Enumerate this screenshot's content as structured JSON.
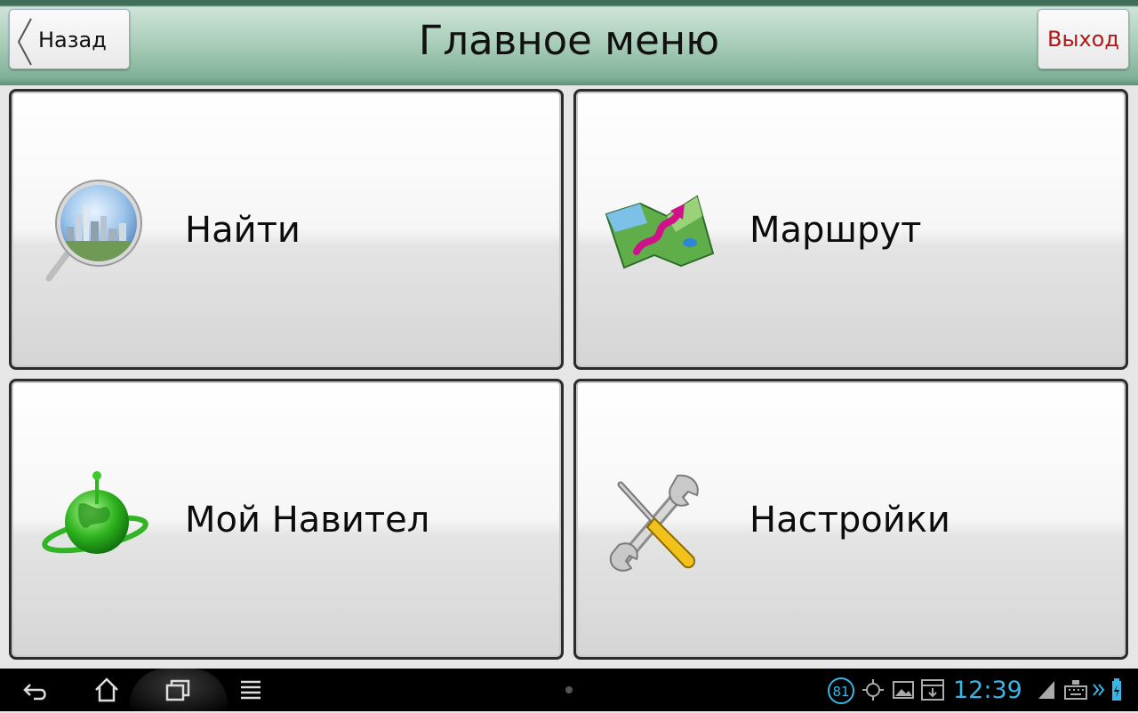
{
  "header": {
    "title": "Главное меню",
    "back_label": "Назад",
    "exit_label": "Выход"
  },
  "menu": {
    "items": [
      {
        "label": "Найти",
        "icon": "search-city-icon"
      },
      {
        "label": "Маршрут",
        "icon": "route-map-icon"
      },
      {
        "label": "Мой Навител",
        "icon": "globe-icon"
      },
      {
        "label": "Настройки",
        "icon": "tools-icon"
      }
    ]
  },
  "statusbar": {
    "time": "12:39",
    "badge": "81",
    "icons": [
      "gps-icon",
      "gallery-icon",
      "download-icon",
      "signal-icon",
      "keyboard-icon",
      "battery-icon"
    ]
  },
  "navbar": {
    "icons": [
      "back-icon",
      "home-icon",
      "recent-apps-icon",
      "menu-icon"
    ]
  },
  "colors": {
    "header_green": "#7fb097",
    "exit_red": "#b01818",
    "clock_blue": "#39b6e6"
  }
}
